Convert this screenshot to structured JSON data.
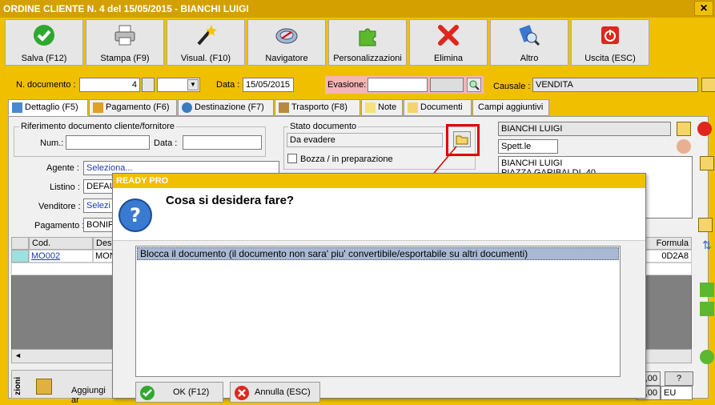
{
  "window": {
    "title": "ORDINE CLIENTE N. 4 del 15/05/2015 - BIANCHI LUIGI",
    "close": "×"
  },
  "toolbar": [
    {
      "label": "Salva (F12)",
      "icon": "checkmark-icon"
    },
    {
      "label": "Stampa (F9)",
      "icon": "printer-icon"
    },
    {
      "label": "Visual. (F10)",
      "icon": "magic-wand-icon"
    },
    {
      "label": "Navigatore",
      "icon": "compass-icon"
    },
    {
      "label": "Personalizzazioni",
      "icon": "puzzle-icon"
    },
    {
      "label": "Elimina",
      "icon": "delete-x-icon"
    },
    {
      "label": "Altro",
      "icon": "altro-icon"
    },
    {
      "label": "Uscita (ESC)",
      "icon": "power-icon"
    }
  ],
  "header": {
    "doc_num_label": "N. documento :",
    "doc_num_value": "4",
    "data_label": "Data :",
    "data_value": "15/05/2015",
    "evasione_label": "Evasione:",
    "causale_label": "Causale :",
    "causale_value": "VENDITA"
  },
  "tabs": [
    {
      "label": "Dettaglio (F5)",
      "active": true
    },
    {
      "label": "Pagamento (F6)"
    },
    {
      "label": "Destinazione (F7)"
    },
    {
      "label": "Trasporto (F8)"
    },
    {
      "label": "Note"
    },
    {
      "label": "Documenti"
    },
    {
      "label": "Campi aggiuntivi"
    }
  ],
  "rif": {
    "group_label": "Riferimento documento cliente/fornitore",
    "num_label": "Num.:",
    "data_label": "Data :"
  },
  "stato": {
    "group_label": "Stato documento",
    "value": "Da evadere",
    "bozza_label": "Bozza / in preparazione"
  },
  "fields": {
    "agente_label": "Agente :",
    "agente_value": "Seleziona...",
    "listino_label": "Listino :",
    "listino_value": "DEFAU",
    "venditore_label": "Venditore :",
    "venditore_value": "Selezi",
    "pagamento_label": "Pagamento :",
    "pagamento_value": "BONIF"
  },
  "customer": {
    "name": "BIANCHI LUIGI",
    "salutation": "Spett.le",
    "address_line1": "BIANCHI LUIGI",
    "address_line2": "PIAZZA GARIBALDI, 40"
  },
  "grid": {
    "col_cod": "Cod.",
    "col_desc": "Desc",
    "col_formula": "Formula",
    "row_code": "MO002",
    "row_desc": "MON",
    "row_formula": "0D2A8"
  },
  "bottom": {
    "add_label": "Aggiungi ar",
    "side_label": "zioni",
    "total1": "0,00",
    "total2": "0,00",
    "currency": "EU",
    "question_mark": "?"
  },
  "dialog": {
    "title": "READY PRO",
    "question": "Cosa si desidera fare?",
    "options": [
      "Blocca il documento (il documento non sara' piu' convertibile/esportabile su altri documenti)"
    ],
    "ok_label": "OK (F12)",
    "cancel_label": "Annulla (ESC)"
  },
  "colors": {
    "accent": "#f0c000",
    "selection": "#a9b9d4",
    "highlight_box": "#e00000"
  }
}
